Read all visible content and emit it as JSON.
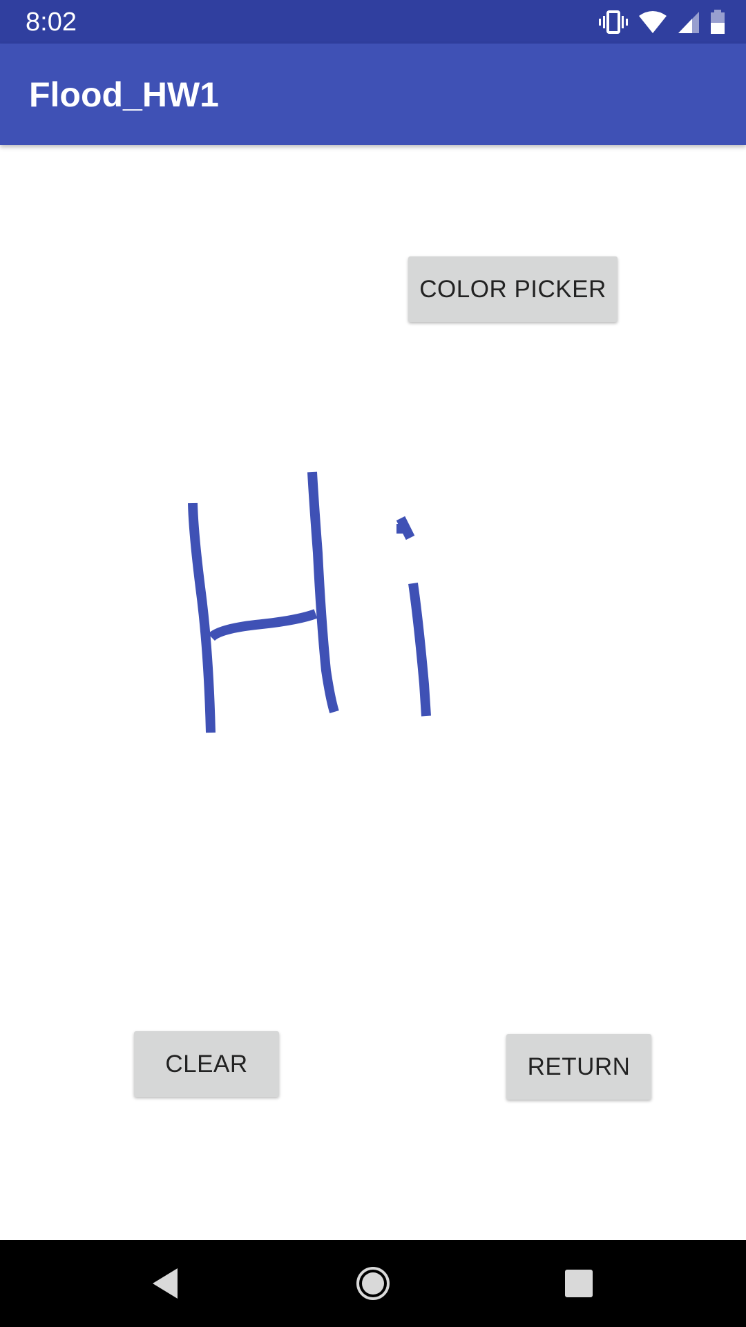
{
  "status_bar": {
    "time": "8:02",
    "icons": [
      "vibrate-icon",
      "wifi-icon",
      "cell-signal-icon",
      "battery-icon"
    ]
  },
  "app_bar": {
    "title": "Flood_HW1"
  },
  "buttons": {
    "color_picker": "COLOR PICKER",
    "clear": "CLEAR",
    "return": "RETURN"
  },
  "drawing": {
    "stroke_color": "#3F51B5",
    "content": "Hi"
  },
  "nav_bar": {
    "icons": [
      "back-icon",
      "home-icon",
      "recents-icon"
    ]
  },
  "colors": {
    "status_bar": "#303F9F",
    "app_bar": "#3F51B5",
    "button_bg": "#D6D7D7"
  }
}
